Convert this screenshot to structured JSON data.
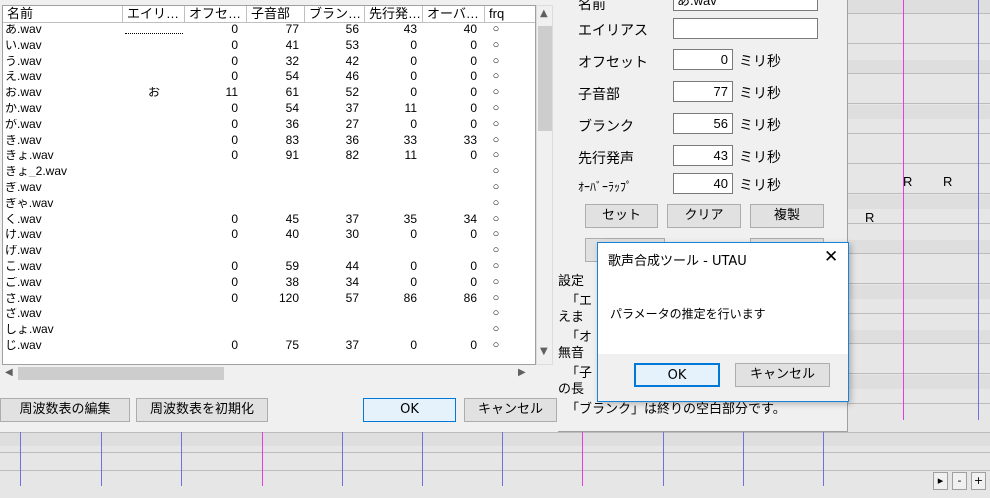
{
  "table": {
    "columns": [
      "名前",
      "エイリ…",
      "オフセ…",
      "子音部",
      "ブラン…",
      "先行発…",
      "オーバ…",
      "frq"
    ],
    "rows": [
      {
        "name": "あ.wav",
        "alias": "",
        "offset": "0",
        "consonant": "77",
        "blank": "56",
        "preutter": "43",
        "overlap": "40",
        "frq": "○"
      },
      {
        "name": "い.wav",
        "alias": "",
        "offset": "0",
        "consonant": "41",
        "blank": "53",
        "preutter": "0",
        "overlap": "0",
        "frq": "○"
      },
      {
        "name": "う.wav",
        "alias": "",
        "offset": "0",
        "consonant": "32",
        "blank": "42",
        "preutter": "0",
        "overlap": "0",
        "frq": "○"
      },
      {
        "name": "え.wav",
        "alias": "",
        "offset": "0",
        "consonant": "54",
        "blank": "46",
        "preutter": "0",
        "overlap": "0",
        "frq": "○"
      },
      {
        "name": "お.wav",
        "alias": "お",
        "offset": "11",
        "consonant": "61",
        "blank": "52",
        "preutter": "0",
        "overlap": "0",
        "frq": "○"
      },
      {
        "name": "か.wav",
        "alias": "",
        "offset": "0",
        "consonant": "54",
        "blank": "37",
        "preutter": "11",
        "overlap": "0",
        "frq": "○"
      },
      {
        "name": "が.wav",
        "alias": "",
        "offset": "0",
        "consonant": "36",
        "blank": "27",
        "preutter": "0",
        "overlap": "0",
        "frq": "○"
      },
      {
        "name": "き.wav",
        "alias": "",
        "offset": "0",
        "consonant": "83",
        "blank": "36",
        "preutter": "33",
        "overlap": "33",
        "frq": "○"
      },
      {
        "name": "きょ.wav",
        "alias": "",
        "offset": "0",
        "consonant": "91",
        "blank": "82",
        "preutter": "11",
        "overlap": "0",
        "frq": "○"
      },
      {
        "name": "きょ_2.wav",
        "alias": "",
        "offset": "",
        "consonant": "",
        "blank": "",
        "preutter": "",
        "overlap": "",
        "frq": "○"
      },
      {
        "name": "ぎ.wav",
        "alias": "",
        "offset": "",
        "consonant": "",
        "blank": "",
        "preutter": "",
        "overlap": "",
        "frq": "○"
      },
      {
        "name": "ぎゃ.wav",
        "alias": "",
        "offset": "",
        "consonant": "",
        "blank": "",
        "preutter": "",
        "overlap": "",
        "frq": "○"
      },
      {
        "name": "く.wav",
        "alias": "",
        "offset": "0",
        "consonant": "45",
        "blank": "37",
        "preutter": "35",
        "overlap": "34",
        "frq": "○"
      },
      {
        "name": "け.wav",
        "alias": "",
        "offset": "0",
        "consonant": "40",
        "blank": "30",
        "preutter": "0",
        "overlap": "0",
        "frq": "○"
      },
      {
        "name": "げ.wav",
        "alias": "",
        "offset": "",
        "consonant": "",
        "blank": "",
        "preutter": "",
        "overlap": "",
        "frq": "○"
      },
      {
        "name": "こ.wav",
        "alias": "",
        "offset": "0",
        "consonant": "59",
        "blank": "44",
        "preutter": "0",
        "overlap": "0",
        "frq": "○"
      },
      {
        "name": "ご.wav",
        "alias": "",
        "offset": "0",
        "consonant": "38",
        "blank": "34",
        "preutter": "0",
        "overlap": "0",
        "frq": "○"
      },
      {
        "name": "さ.wav",
        "alias": "",
        "offset": "0",
        "consonant": "120",
        "blank": "57",
        "preutter": "86",
        "overlap": "86",
        "frq": "○"
      },
      {
        "name": "ざ.wav",
        "alias": "",
        "offset": "",
        "consonant": "",
        "blank": "",
        "preutter": "",
        "overlap": "",
        "frq": "○"
      },
      {
        "name": "しょ.wav",
        "alias": "",
        "offset": "",
        "consonant": "",
        "blank": "",
        "preutter": "",
        "overlap": "",
        "frq": "○"
      },
      {
        "name": "じ.wav",
        "alias": "",
        "offset": "0",
        "consonant": "75",
        "blank": "37",
        "preutter": "0",
        "overlap": "0",
        "frq": "○"
      }
    ]
  },
  "buttons": {
    "edit_freq": "周波数表の編集",
    "init_freq": "周波数表を初期化",
    "ok": "OK",
    "cancel": "キャンセル"
  },
  "params": {
    "name_label": "名前",
    "name_value": "あ.wav",
    "alias_label": "エイリアス",
    "alias_value": "",
    "offset_label": "オフセット",
    "offset_value": "0",
    "consonant_label": "子音部",
    "consonant_value": "77",
    "blank_label": "ブランク",
    "blank_value": "56",
    "preutter_label": "先行発声",
    "preutter_value": "43",
    "overlap_label": "ｵｰﾊﾞｰﾗｯﾌﾟ",
    "overlap_value": "40",
    "unit": "ミリ秒",
    "set_button": "セット",
    "clear_button": "クリア",
    "duplicate_button": "複製",
    "help_line1": "設定",
    "help_line2": "「エ",
    "help_line3": "えま",
    "help_line4": "「オ",
    "help_line5": "無音",
    "help_line6": "「子",
    "help_line7": "の長",
    "help_line8": "「ブランク」は終りの空白部分です。"
  },
  "roll_labels": [
    "R",
    "R",
    "R"
  ],
  "dialog": {
    "title": "歌声合成ツール - UTAU",
    "message": "パラメータの推定を行います",
    "ok": "OK",
    "cancel": "キャンセル"
  },
  "zoom": {
    "minus": "-",
    "plus": "+",
    "play": "▸"
  }
}
